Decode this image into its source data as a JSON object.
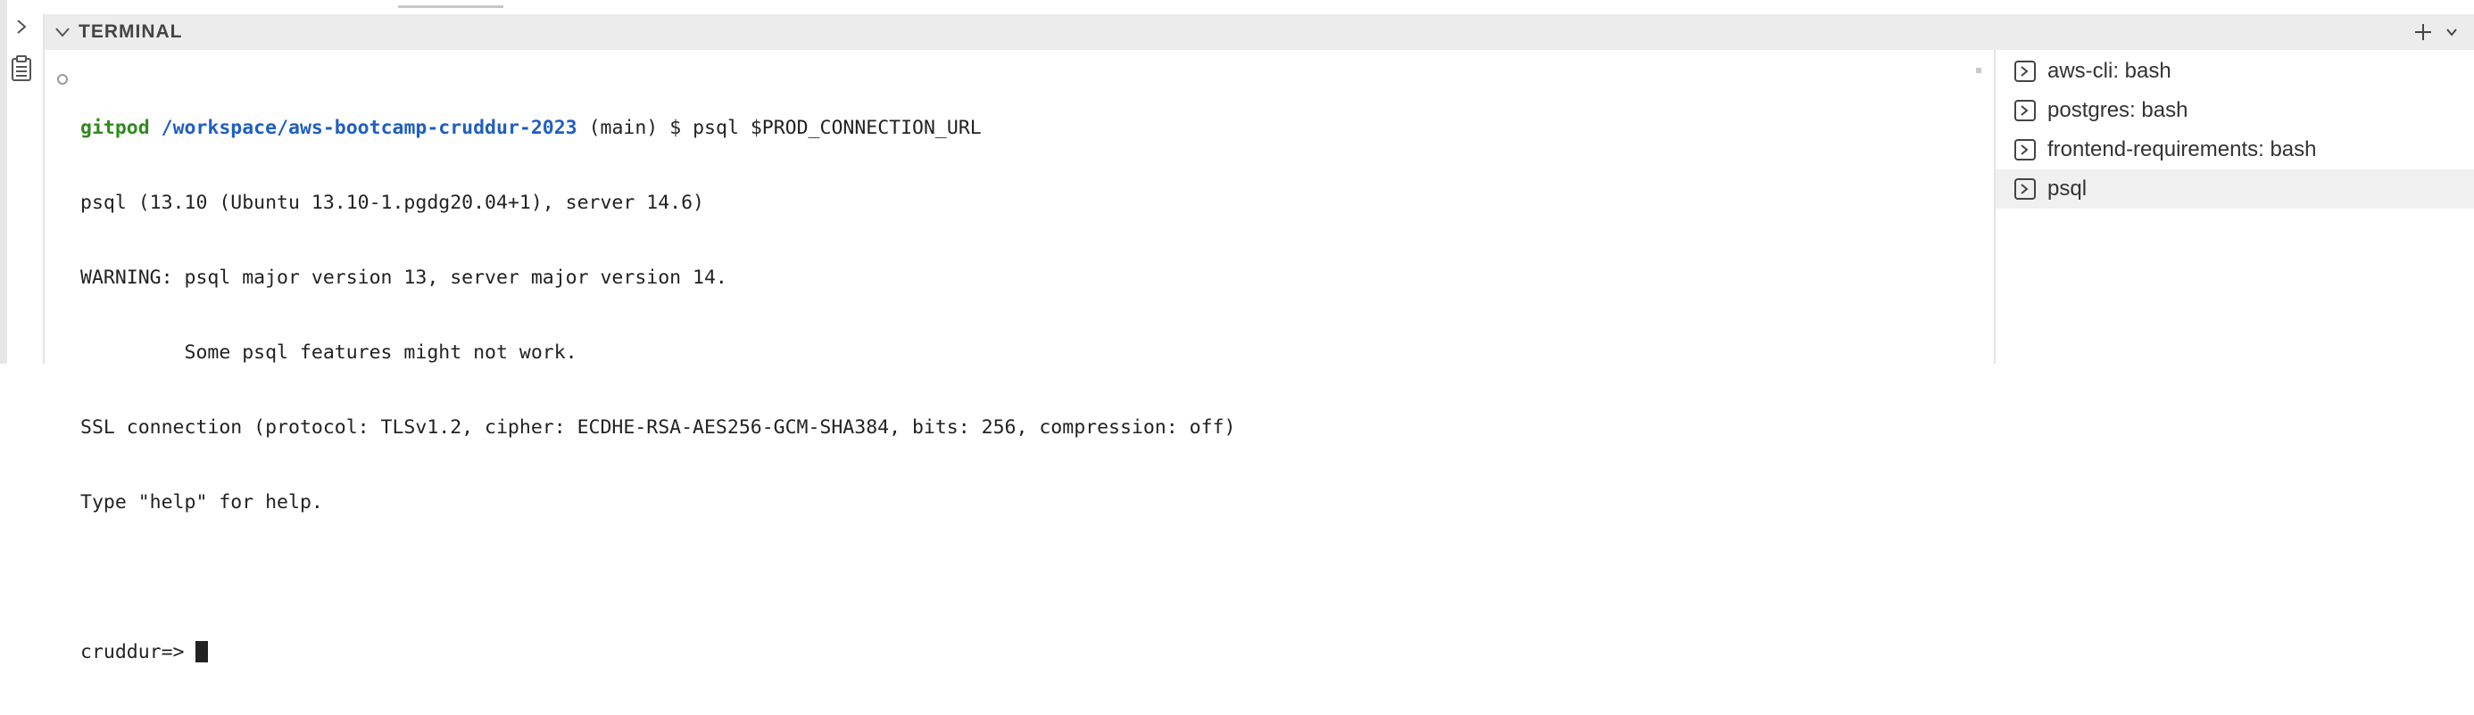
{
  "panel": {
    "title": "TERMINAL",
    "actions": {
      "new_terminal_icon": "plus-icon",
      "dropdown_icon": "chevron-down-icon"
    }
  },
  "terminal": {
    "prompt": {
      "host": "gitpod",
      "path": "/workspace/aws-bootcamp-cruddur-2023",
      "branch": "(main)",
      "symbol": "$",
      "command": "psql $PROD_CONNECTION_URL"
    },
    "output": [
      "psql (13.10 (Ubuntu 13.10-1.pgdg20.04+1), server 14.6)",
      "WARNING: psql major version 13, server major version 14.",
      "         Some psql features might not work.",
      "SSL connection (protocol: TLSv1.2, cipher: ECDHE-RSA-AES256-GCM-SHA384, bits: 256, compression: off)",
      "Type \"help\" for help.",
      ""
    ],
    "current_prompt": "cruddur=> "
  },
  "tabs": [
    {
      "label": "aws-cli: bash",
      "active": false
    },
    {
      "label": "postgres: bash",
      "active": false
    },
    {
      "label": "frontend-requirements: bash",
      "active": false
    },
    {
      "label": "psql",
      "active": true
    }
  ],
  "colors": {
    "host": "#2e8b1e",
    "path": "#1f5fbf",
    "header_bg": "#ececec"
  }
}
